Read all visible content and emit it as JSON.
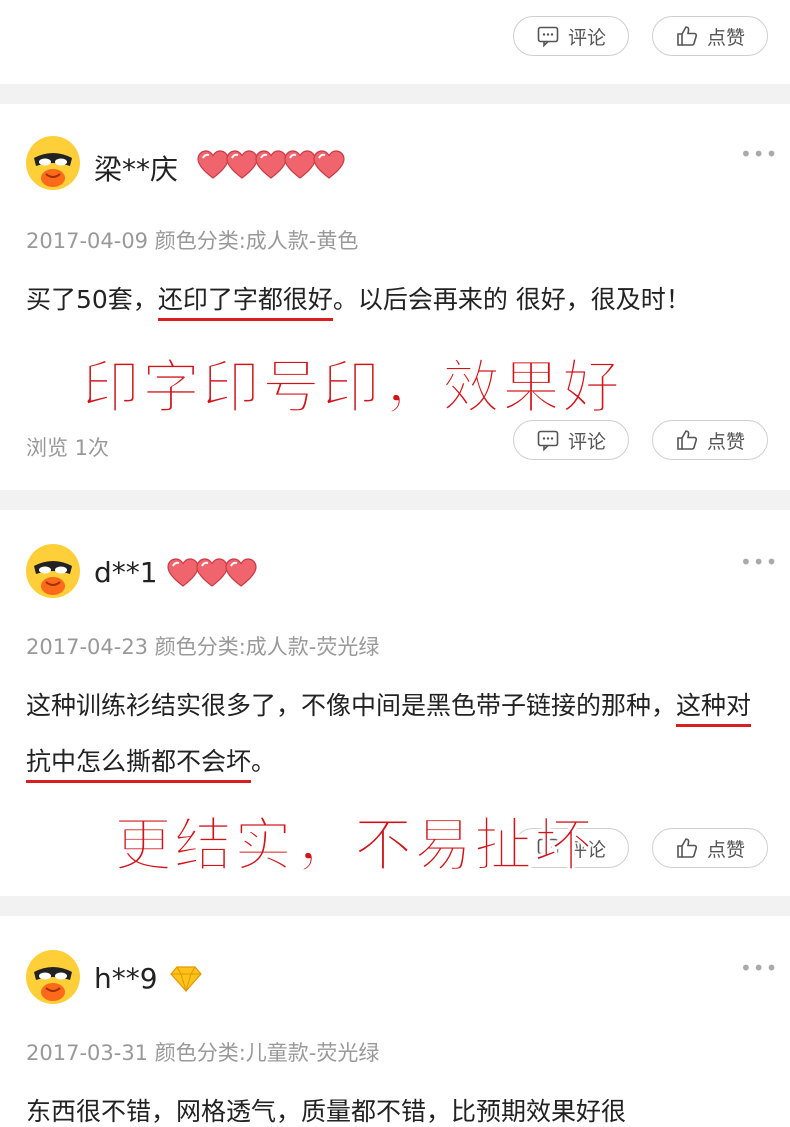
{
  "buttons": {
    "comment": "评论",
    "like": "点赞"
  },
  "reviews": [
    {
      "username": "梁**庆",
      "heart_count": 5,
      "meta": "2017-04-09 颜色分类:成人款-黄色",
      "content_plain_1": "买了50套，",
      "content_underlined": "还印了字都很好",
      "content_plain_2": "。以后会再来的 很好，很及时！",
      "views": "浏览 1次",
      "overlay": "印字印号印，效果好"
    },
    {
      "username": "d**1",
      "heart_count": 3,
      "meta": "2017-04-23 颜色分类:成人款-荧光绿",
      "content_plain_1": "这种训练衫结实很多了，不像中间是黑色带子链接的那种，",
      "content_underlined": "这种对抗中怎么撕都不会坏",
      "content_plain_2": "。",
      "overlay": "更结实，不易扯坏"
    },
    {
      "username": "h**9",
      "badge": "diamond",
      "meta": "2017-03-31 颜色分类:儿童款-荧光绿",
      "content_plain_1": "东西很不错，网格透气，质量都不错，比预期效果好很"
    }
  ],
  "icons": {
    "comment": "comment-icon",
    "like": "thumbs-up-icon",
    "more": "more-dots-icon",
    "heart": "heart-level-icon",
    "diamond": "diamond-level-icon"
  },
  "colors": {
    "accent_red": "#d0141a",
    "underline_red": "#d81e1e",
    "divider": "#f2f2f2",
    "meta_gray": "#999999"
  }
}
